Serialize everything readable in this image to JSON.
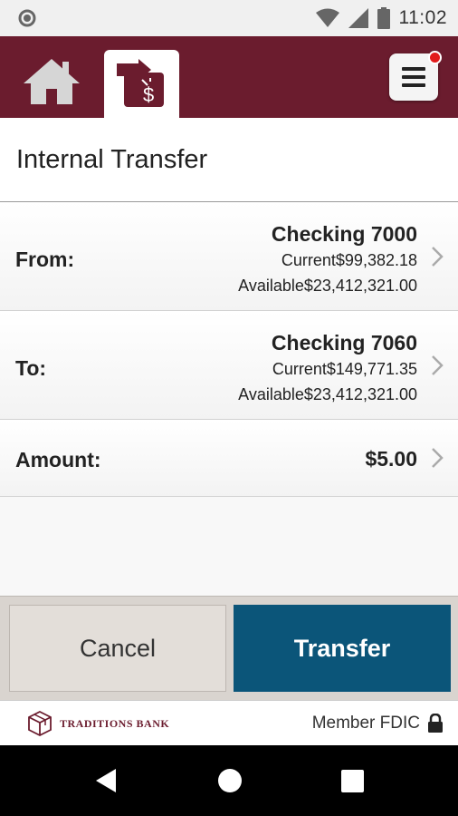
{
  "status_bar": {
    "time": "11:02",
    "icons": [
      "circle-notification-icon",
      "wifi-icon",
      "signal-icon",
      "battery-icon"
    ]
  },
  "header": {
    "colors": {
      "background": "#6b1c2e",
      "active_tab": "#ffffff"
    },
    "tabs": [
      {
        "name": "home",
        "icon": "home-icon"
      },
      {
        "name": "transfer",
        "icon": "transfer-dollar-icon",
        "active": true
      }
    ],
    "menu_icon": "hamburger-menu-icon",
    "has_notification": true
  },
  "page": {
    "title": "Internal Transfer"
  },
  "from": {
    "label": "From:",
    "account": "Checking 7000",
    "current_label": "Current",
    "current_value": "$99,382.18",
    "available_label": "Available",
    "available_value": "$23,412,321.00"
  },
  "to": {
    "label": "To:",
    "account": "Checking 7060",
    "current_label": "Current",
    "current_value": "$149,771.35",
    "available_label": "Available",
    "available_value": "$23,412,321.00"
  },
  "amount": {
    "label": "Amount:",
    "value": "$5.00"
  },
  "actions": {
    "cancel_label": "Cancel",
    "transfer_label": "Transfer",
    "colors": {
      "transfer": "#0b5579",
      "cancel": "#e3ded9"
    }
  },
  "footer": {
    "bank_name": "TRADITIONS BANK",
    "fdic_text": "Member FDIC"
  },
  "nav_bar": {
    "icons": [
      "back-icon",
      "home-circle-icon",
      "recents-icon"
    ]
  }
}
